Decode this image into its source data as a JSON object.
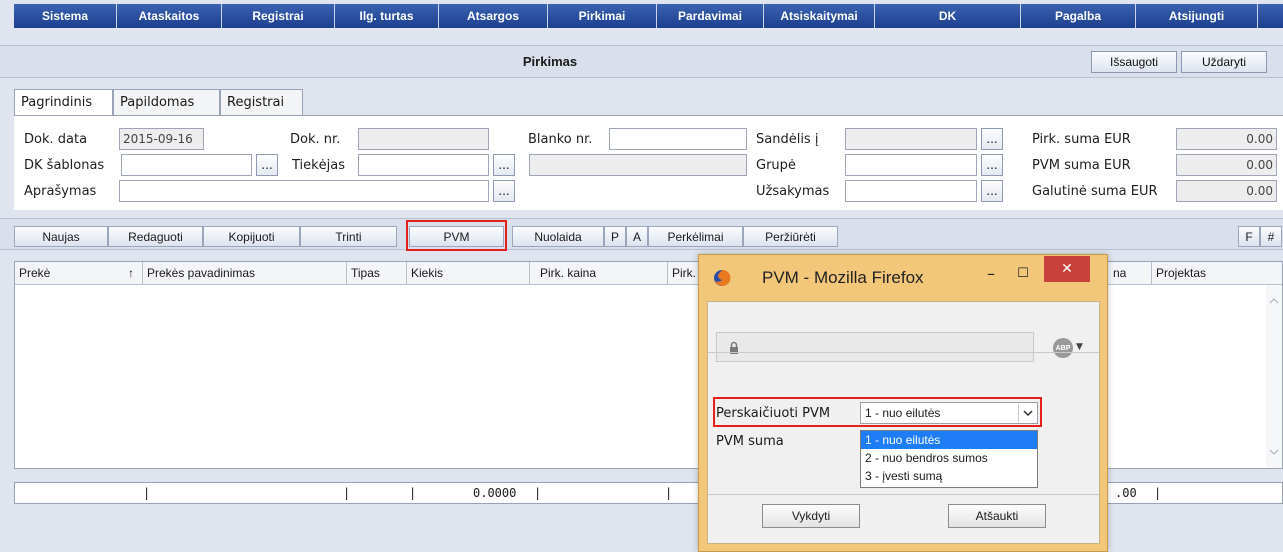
{
  "menu": [
    "Sistema",
    "Ataskaitos",
    "Registrai",
    "Ilg. turtas",
    "Atsargos",
    "Pirkimai",
    "Pardavimai",
    "Atsiskaitymai",
    "DK",
    "Pagalba",
    "Atsijungti"
  ],
  "header": {
    "title": "Pirkimas",
    "save_label": "Išsaugoti",
    "close_label": "Uždaryti"
  },
  "tabs": [
    "Pagrindinis",
    "Papildomas",
    "Registrai"
  ],
  "form": {
    "dok_data_label": "Dok. data",
    "dok_data_value": "2015-09-16",
    "dok_nr_label": "Dok. nr.",
    "blanko_nr_label": "Blanko nr.",
    "sandelis_label": "Sandėlis į",
    "pirk_suma_label": "Pirk. suma EUR",
    "pirk_suma_value": "0.00",
    "dk_sablonas_label": "DK šablonas",
    "tiekejas_label": "Tiekėjas",
    "grupe_label": "Grupė",
    "pvm_suma_label": "PVM suma EUR",
    "pvm_suma_value": "0.00",
    "aprasymas_label": "Aprašymas",
    "uzsakymas_label": "Užsakymas",
    "galutine_suma_label": "Galutinė suma EUR",
    "galutine_suma_value": "0.00",
    "dots": "..."
  },
  "toolbar": {
    "naujas": "Naujas",
    "redaguoti": "Redaguoti",
    "kopijuoti": "Kopijuoti",
    "trinti": "Trinti",
    "pvm": "PVM",
    "nuolaida": "Nuolaida",
    "p": "P",
    "a": "A",
    "perkelimai": "Perkėlimai",
    "perziureti": "Peržiūrėti",
    "f": "F",
    "hash": "#"
  },
  "grid": {
    "columns": [
      "Prekė",
      "↑",
      "Prekės pavadinimas",
      "Tipas",
      "Kiekis",
      "Pirk. kaina",
      "Pirk."
    ],
    "columns_right": [
      "na",
      "Projektas"
    ],
    "totals_value": "0.0000",
    "totals_right": ".00"
  },
  "popup": {
    "title": "PVM - Mozilla Firefox",
    "min": "–",
    "max": "☐",
    "close": "✕",
    "abp": "ABP",
    "perskaiciuoti_label": "Perskaičiuoti PVM",
    "selected": "1 - nuo eilutės",
    "pvm_suma_label": "PVM suma",
    "options": [
      "1 - nuo eilutės",
      "2 - nuo bendros sumos",
      "3 - įvesti sumą"
    ],
    "vykdyti": "Vykdyti",
    "atsaukti": "Atšaukti"
  },
  "colors": {
    "menu_blue": "#1d3f8f",
    "highlight_red": "#e3201b",
    "firefox_frame": "#f2c77a",
    "close_red": "#c8413a",
    "selected_option": "#1e7cf5"
  }
}
